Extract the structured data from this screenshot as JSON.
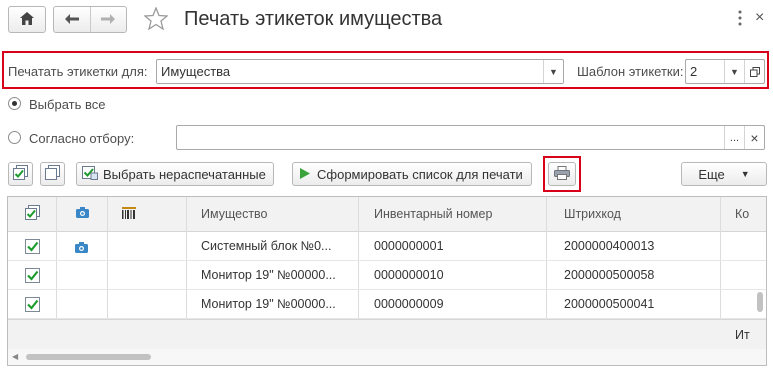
{
  "window": {
    "title": "Печать этикеток имущества"
  },
  "params": {
    "print_for_label": "Печатать этикетки для:",
    "print_for_value": "Имущества",
    "template_label": "Шаблон этикетки:",
    "template_value": "2"
  },
  "options": {
    "select_all_label": "Выбрать все",
    "by_filter_label": "Согласно отбору:",
    "filter_button": "...",
    "clear_button": "×"
  },
  "toolbar": {
    "select_unprinted_label": "Выбрать нераспечатанные",
    "generate_list_label": "Сформировать список для печати",
    "more_label": "Еще"
  },
  "table": {
    "columns": [
      "Имущество",
      "Инвентарный номер",
      "Штрихкод",
      "Ко"
    ],
    "rows": [
      {
        "checked": true,
        "photo": true,
        "name": "Системный блок №0...",
        "inv": "0000000001",
        "barcode": "2000000400013"
      },
      {
        "checked": true,
        "photo": false,
        "name": "Монитор 19\" №00000...",
        "inv": "0000000010",
        "barcode": "2000000500058"
      },
      {
        "checked": true,
        "photo": false,
        "name": "Монитор 19\" №00000...",
        "inv": "0000000009",
        "barcode": "2000000500041"
      }
    ],
    "footer_text": "Ит"
  },
  "colors": {
    "highlight": "#d9001a",
    "check": "#1e9b2e",
    "accent": "#3a87c8"
  },
  "icons": [
    "home-icon",
    "back-arrow-icon",
    "forward-arrow-icon",
    "star-icon",
    "more-vert-icon",
    "close-icon",
    "copy-icon",
    "check-all-icon",
    "uncheck-all-icon",
    "select-unprinted-icon",
    "play-icon",
    "printer-icon",
    "camera-icon",
    "barcode-icon"
  ]
}
